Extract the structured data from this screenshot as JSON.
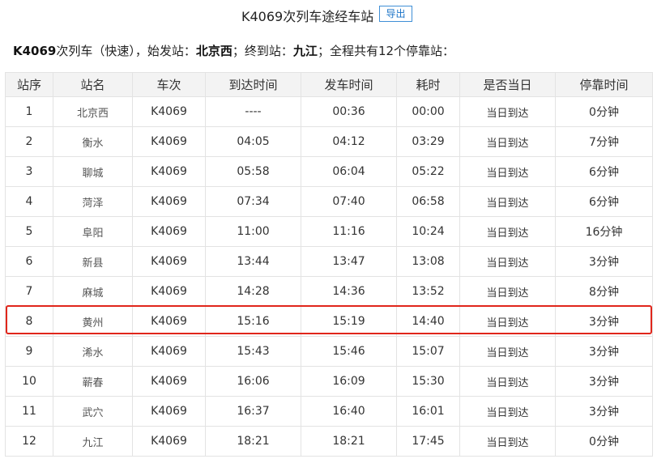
{
  "header": {
    "title": "K4069次列车途经车站",
    "export_label": "导出"
  },
  "summary": {
    "train": "K4069",
    "text_after_train": "次列车（快速），始发站：",
    "origin": "北京西",
    "text_after_origin": "；终到站：",
    "terminal": "九江",
    "text_after_terminal": "；全程共有12个停靠站："
  },
  "table": {
    "headers": [
      "站序",
      "站名",
      "车次",
      "到达时间",
      "发车时间",
      "耗时",
      "是否当日",
      "停靠时间"
    ],
    "rows": [
      [
        "1",
        "北京西",
        "K4069",
        "----",
        "00:36",
        "00:00",
        "当日到达",
        "0分钟"
      ],
      [
        "2",
        "衡水",
        "K4069",
        "04:05",
        "04:12",
        "03:29",
        "当日到达",
        "7分钟"
      ],
      [
        "3",
        "聊城",
        "K4069",
        "05:58",
        "06:04",
        "05:22",
        "当日到达",
        "6分钟"
      ],
      [
        "4",
        "菏泽",
        "K4069",
        "07:34",
        "07:40",
        "06:58",
        "当日到达",
        "6分钟"
      ],
      [
        "5",
        "阜阳",
        "K4069",
        "11:00",
        "11:16",
        "10:24",
        "当日到达",
        "16分钟"
      ],
      [
        "6",
        "新县",
        "K4069",
        "13:44",
        "13:47",
        "13:08",
        "当日到达",
        "3分钟"
      ],
      [
        "7",
        "麻城",
        "K4069",
        "14:28",
        "14:36",
        "13:52",
        "当日到达",
        "8分钟"
      ],
      [
        "8",
        "黄州",
        "K4069",
        "15:16",
        "15:19",
        "14:40",
        "当日到达",
        "3分钟"
      ],
      [
        "9",
        "浠水",
        "K4069",
        "15:43",
        "15:46",
        "15:07",
        "当日到达",
        "3分钟"
      ],
      [
        "10",
        "蕲春",
        "K4069",
        "16:06",
        "16:09",
        "15:30",
        "当日到达",
        "3分钟"
      ],
      [
        "11",
        "武穴",
        "K4069",
        "16:37",
        "16:40",
        "16:01",
        "当日到达",
        "3分钟"
      ],
      [
        "12",
        "九江",
        "K4069",
        "18:21",
        "18:21",
        "17:45",
        "当日到达",
        "0分钟"
      ]
    ],
    "highlighted_row": 8
  },
  "colors": {
    "highlight": "#e0261b",
    "header_bg": "#f3f3f3",
    "export_border": "#3f8fd6"
  }
}
